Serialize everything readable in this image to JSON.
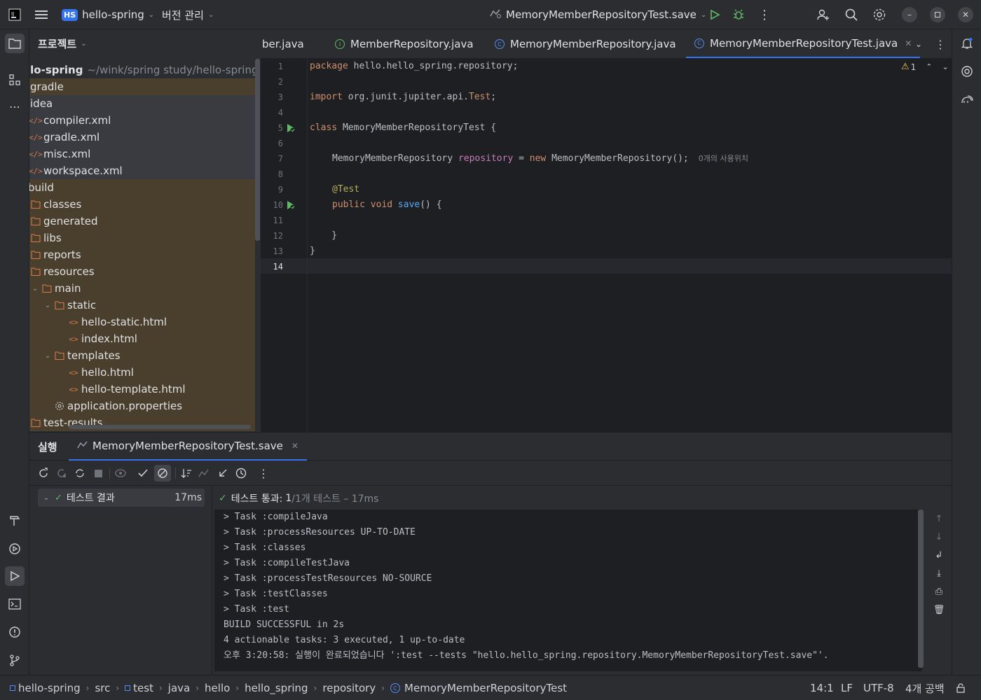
{
  "titlebar": {
    "project_badge": "HS",
    "project_name": "hello-spring",
    "vcs_menu": "버전 관리",
    "run_config": "MemoryMemberRepositoryTest.save"
  },
  "project_panel": {
    "title": "프로젝트",
    "root_name": "llo-spring",
    "root_path": "~/wink/spring study/hello-spring",
    "items": [
      {
        "label": "gradle"
      },
      {
        "label": "idea"
      },
      {
        "label": "compiler.xml"
      },
      {
        "label": "gradle.xml"
      },
      {
        "label": "misc.xml"
      },
      {
        "label": "workspace.xml"
      },
      {
        "label": "build"
      },
      {
        "label": "classes"
      },
      {
        "label": "generated"
      },
      {
        "label": "libs"
      },
      {
        "label": "reports"
      },
      {
        "label": "resources"
      },
      {
        "label": "main"
      },
      {
        "label": "static"
      },
      {
        "label": "hello-static.html"
      },
      {
        "label": "index.html"
      },
      {
        "label": "templates"
      },
      {
        "label": "hello.html"
      },
      {
        "label": "hello-template.html"
      },
      {
        "label": "application.properties"
      },
      {
        "label": "test-results"
      }
    ]
  },
  "editor_tabs": [
    {
      "label": "ber.java"
    },
    {
      "label": "MemberRepository.java"
    },
    {
      "label": "MemoryMemberRepository.java"
    },
    {
      "label": "MemoryMemberRepositoryTest.java",
      "active": true
    }
  ],
  "editor": {
    "warning_count": "1",
    "line_numbers": [
      "1",
      "2",
      "3",
      "4",
      "5",
      "6",
      "7",
      "8",
      "9",
      "10",
      "11",
      "12",
      "13",
      "14"
    ],
    "code": {
      "l1_kw": "package",
      "l1_rest": " hello.hello_spring.repository;",
      "l3_kw": "import",
      "l3_rest": " org.junit.jupiter.api.",
      "l3_cls": "Test",
      "l3_end": ";",
      "l5_kw": "class",
      "l5_rest": " MemoryMemberRepositoryTest {",
      "l7_type": "MemoryMemberRepository ",
      "l7_field": "repository",
      "l7_eq": " = ",
      "l7_new": "new",
      "l7_rest": " MemoryMemberRepository();",
      "l7_hint": "0개의 사용위치",
      "l9_ann": "@Test",
      "l10_kw": "public void",
      "l10_fn": " save",
      "l10_rest": "() {",
      "l12": "    }",
      "l13": "}"
    }
  },
  "run_panel": {
    "tab_label": "실행",
    "config_tab": "MemoryMemberRepositoryTest.save",
    "tree_root": "테스트 결과",
    "tree_time": "17ms",
    "summary_label": "테스트 통과:",
    "summary_count": "1",
    "summary_rest": "/1개 테스트 – 17ms",
    "console_lines": [
      "> Task :compileJava",
      "> Task :processResources UP-TO-DATE",
      "> Task :classes",
      "> Task :compileTestJava",
      "> Task :processTestResources NO-SOURCE",
      "> Task :testClasses",
      "> Task :test",
      "BUILD SUCCESSFUL in 2s",
      "4 actionable tasks: 3 executed, 1 up-to-date",
      "오후 3:20:58: 실행이 완료되었습니다 ':test --tests \"hello.hello_spring.repository.MemoryMemberRepositoryTest.save\"'."
    ]
  },
  "statusbar": {
    "breadcrumbs": [
      "hello-spring",
      "src",
      "test",
      "java",
      "hello",
      "hello_spring",
      "repository",
      "MemoryMemberRepositoryTest"
    ],
    "position": "14:1",
    "line_sep": "LF",
    "encoding": "UTF-8",
    "indent": "4개 공백"
  },
  "colors": {
    "accent": "#3574f0",
    "bg_editor": "#1e1f22",
    "bg_panel": "#2b2d30",
    "keyword": "#cf8e6d",
    "success": "#5fb865"
  }
}
